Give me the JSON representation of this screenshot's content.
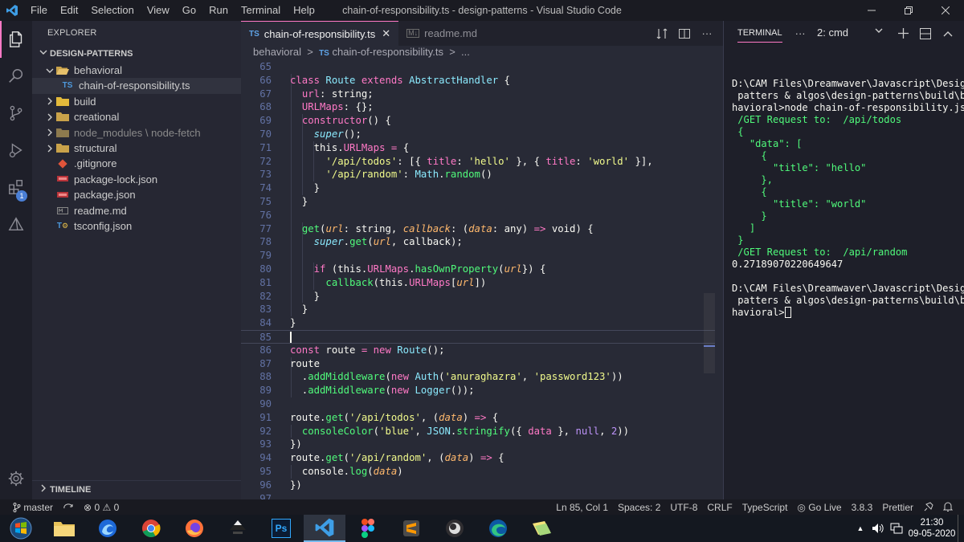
{
  "window": {
    "title": "chain-of-responsibility.ts - design-patterns - Visual Studio Code",
    "menu": [
      "File",
      "Edit",
      "Selection",
      "View",
      "Go",
      "Run",
      "Terminal",
      "Help"
    ]
  },
  "activity_bar": {
    "items": [
      "explorer-icon",
      "search-icon",
      "source-control-icon",
      "run-debug-icon",
      "extensions-icon",
      "remote-icon"
    ],
    "extensions_badge": "1",
    "bottom": "settings-gear-icon"
  },
  "sidebar": {
    "header": "EXPLORER",
    "project": "DESIGN-PATTERNS",
    "tree": [
      {
        "label": "behavioral",
        "kind": "folder-open",
        "depth": 0
      },
      {
        "label": "chain-of-responsibility.ts",
        "kind": "ts",
        "depth": 1,
        "selected": true
      },
      {
        "label": "build",
        "kind": "folder",
        "depth": 0
      },
      {
        "label": "creational",
        "kind": "folder",
        "depth": 0
      },
      {
        "label": "node_modules",
        "suffix": "node-fetch",
        "kind": "folder-dim",
        "depth": 0
      },
      {
        "label": "structural",
        "kind": "folder",
        "depth": 0
      },
      {
        "label": ".gitignore",
        "kind": "git",
        "depth": 0
      },
      {
        "label": "package-lock.json",
        "kind": "npm",
        "depth": 0
      },
      {
        "label": "package.json",
        "kind": "npm",
        "depth": 0
      },
      {
        "label": "readme.md",
        "kind": "md",
        "depth": 0
      },
      {
        "label": "tsconfig.json",
        "kind": "tsconfig",
        "depth": 0
      }
    ],
    "timeline": "TIMELINE"
  },
  "editor": {
    "tabs": [
      {
        "badge": "TS",
        "label": "chain-of-responsibility.ts",
        "active": true
      },
      {
        "badge": "M↓",
        "label": "readme.md",
        "active": false
      }
    ],
    "breadcrumb": {
      "folder": "behavioral",
      "badge": "TS",
      "file": "chain-of-responsibility.ts",
      "tail": "..."
    },
    "current_line": 85,
    "lines": [
      {
        "n": "65",
        "t": []
      },
      {
        "n": "66",
        "t": [
          [
            "k",
            "class "
          ],
          [
            "c",
            "Route "
          ],
          [
            "k",
            "extends "
          ],
          [
            "c",
            "AbstractHandler "
          ],
          [
            "",
            "{"
          ]
        ]
      },
      {
        "n": "67",
        "t": [
          [
            "",
            "  "
          ],
          [
            "k",
            "url"
          ],
          [
            "",
            ": "
          ],
          [
            "",
            "string;"
          ]
        ]
      },
      {
        "n": "68",
        "t": [
          [
            "",
            "  "
          ],
          [
            "k",
            "URLMaps"
          ],
          [
            "",
            ": {};"
          ]
        ]
      },
      {
        "n": "69",
        "t": [
          [
            "",
            "  "
          ],
          [
            "k",
            "constructor"
          ],
          [
            "",
            "() {"
          ]
        ]
      },
      {
        "n": "70",
        "t": [
          [
            "",
            "    "
          ],
          [
            "i",
            "super"
          ],
          [
            "",
            "();"
          ]
        ]
      },
      {
        "n": "71",
        "t": [
          [
            "",
            "    "
          ],
          [
            "",
            "this."
          ],
          [
            "k",
            "URLMaps"
          ],
          [
            "k",
            " = "
          ],
          [
            "",
            "{"
          ]
        ]
      },
      {
        "n": "72",
        "t": [
          [
            "",
            "      "
          ],
          [
            "s",
            "'/api/todos'"
          ],
          [
            "",
            ": [{ "
          ],
          [
            "k",
            "title"
          ],
          [
            "",
            ": "
          ],
          [
            "s",
            "'hello'"
          ],
          [
            "",
            " }, { "
          ],
          [
            "k",
            "title"
          ],
          [
            "",
            ": "
          ],
          [
            "s",
            "'world'"
          ],
          [
            "",
            " }],"
          ]
        ]
      },
      {
        "n": "73",
        "t": [
          [
            "",
            "      "
          ],
          [
            "s",
            "'/api/random'"
          ],
          [
            "",
            ": "
          ],
          [
            "c",
            "Math"
          ],
          [
            "",
            "."
          ],
          [
            "f",
            "random"
          ],
          [
            "",
            "()"
          ]
        ]
      },
      {
        "n": "74",
        "t": [
          [
            "",
            "    }"
          ]
        ]
      },
      {
        "n": "75",
        "t": [
          [
            "",
            "  }"
          ]
        ]
      },
      {
        "n": "76",
        "t": []
      },
      {
        "n": "77",
        "t": [
          [
            "",
            "  "
          ],
          [
            "f",
            "get"
          ],
          [
            "",
            "("
          ],
          [
            "p",
            "url"
          ],
          [
            "",
            ": string, "
          ],
          [
            "p",
            "callback"
          ],
          [
            "",
            ": ("
          ],
          [
            "p",
            "data"
          ],
          [
            "",
            ": any) "
          ],
          [
            "k",
            "=>"
          ],
          [
            "",
            " void) {"
          ]
        ]
      },
      {
        "n": "78",
        "t": [
          [
            "",
            "    "
          ],
          [
            "i",
            "super"
          ],
          [
            "",
            "."
          ],
          [
            "f",
            "get"
          ],
          [
            "",
            "("
          ],
          [
            "p",
            "url"
          ],
          [
            "",
            ", callback);"
          ]
        ]
      },
      {
        "n": "79",
        "t": []
      },
      {
        "n": "80",
        "t": [
          [
            "",
            "    "
          ],
          [
            "k",
            "if"
          ],
          [
            "",
            " (this."
          ],
          [
            "k",
            "URLMaps"
          ],
          [
            "",
            "."
          ],
          [
            "f",
            "hasOwnProperty"
          ],
          [
            "",
            "("
          ],
          [
            "p",
            "url"
          ],
          [
            "",
            "}) {"
          ]
        ]
      },
      {
        "n": "81",
        "t": [
          [
            "",
            "      "
          ],
          [
            "f",
            "callback"
          ],
          [
            "",
            "(this."
          ],
          [
            "k",
            "URLMaps"
          ],
          [
            "",
            "["
          ],
          [
            "p",
            "url"
          ],
          [
            "",
            "])"
          ]
        ]
      },
      {
        "n": "82",
        "t": [
          [
            "",
            "    }"
          ]
        ]
      },
      {
        "n": "83",
        "t": [
          [
            "",
            "  }"
          ]
        ]
      },
      {
        "n": "84",
        "t": [
          [
            "",
            "}"
          ]
        ]
      },
      {
        "n": "85",
        "t": []
      },
      {
        "n": "86",
        "t": [
          [
            "k",
            "const "
          ],
          [
            "",
            "route "
          ],
          [
            "k",
            "= new "
          ],
          [
            "c",
            "Route"
          ],
          [
            "",
            "();"
          ]
        ]
      },
      {
        "n": "87",
        "t": [
          [
            "",
            "route"
          ]
        ]
      },
      {
        "n": "88",
        "t": [
          [
            "",
            "  ."
          ],
          [
            "f",
            "addMiddleware"
          ],
          [
            "",
            "("
          ],
          [
            "k",
            "new "
          ],
          [
            "c",
            "Auth"
          ],
          [
            "",
            "("
          ],
          [
            "s",
            "'anuraghazra'"
          ],
          [
            "",
            ", "
          ],
          [
            "s",
            "'password123'"
          ],
          [
            "",
            "))"
          ]
        ]
      },
      {
        "n": "89",
        "t": [
          [
            "",
            "  ."
          ],
          [
            "f",
            "addMiddleware"
          ],
          [
            "",
            "("
          ],
          [
            "k",
            "new "
          ],
          [
            "c",
            "Logger"
          ],
          [
            "",
            "());"
          ]
        ]
      },
      {
        "n": "90",
        "t": []
      },
      {
        "n": "91",
        "t": [
          [
            "",
            "route."
          ],
          [
            "f",
            "get"
          ],
          [
            "",
            "("
          ],
          [
            "s",
            "'/api/todos'"
          ],
          [
            "",
            ", ("
          ],
          [
            "p",
            "data"
          ],
          [
            "",
            ") "
          ],
          [
            "k",
            "=>"
          ],
          [
            "",
            " {"
          ]
        ]
      },
      {
        "n": "92",
        "t": [
          [
            "",
            "  "
          ],
          [
            "f",
            "consoleColor"
          ],
          [
            "",
            "("
          ],
          [
            "s",
            "'blue'"
          ],
          [
            "",
            ", "
          ],
          [
            "c",
            "JSON"
          ],
          [
            "",
            "."
          ],
          [
            "f",
            "stringify"
          ],
          [
            "",
            "({ "
          ],
          [
            "k",
            "data"
          ],
          [
            "",
            " }, "
          ],
          [
            "n",
            "null"
          ],
          [
            "",
            ", "
          ],
          [
            "n",
            "2"
          ],
          [
            "",
            "))"
          ]
        ]
      },
      {
        "n": "93",
        "t": [
          [
            "",
            "})"
          ]
        ]
      },
      {
        "n": "94",
        "t": [
          [
            "",
            "route."
          ],
          [
            "f",
            "get"
          ],
          [
            "",
            "("
          ],
          [
            "s",
            "'/api/random'"
          ],
          [
            "",
            ", ("
          ],
          [
            "p",
            "data"
          ],
          [
            "",
            ") "
          ],
          [
            "k",
            "=>"
          ],
          [
            "",
            " {"
          ]
        ]
      },
      {
        "n": "95",
        "t": [
          [
            "",
            "  "
          ],
          [
            "",
            "console."
          ],
          [
            "f",
            "log"
          ],
          [
            "",
            "("
          ],
          [
            "p",
            "data"
          ],
          [
            "",
            ")"
          ]
        ]
      },
      {
        "n": "96",
        "t": [
          [
            "",
            "})"
          ]
        ]
      },
      {
        "n": "97",
        "t": []
      }
    ]
  },
  "panel": {
    "tab": "TERMINAL",
    "terminal_select": "2: cmd",
    "output": [
      {
        "text": "",
        "style": ""
      },
      {
        "text": "D:\\CAM Files\\Dreamwaver\\Javascript\\Design",
        "style": ""
      },
      {
        "text": " patters & algos\\design-patterns\\build\\be",
        "style": ""
      },
      {
        "text": "havioral>node chain-of-responsibility.js",
        "style": ""
      },
      {
        "text": " /GET Request to:  /api/todos",
        "style": "green"
      },
      {
        "text": " {",
        "style": "green"
      },
      {
        "text": "   \"data\": [",
        "style": "green"
      },
      {
        "text": "     {",
        "style": "green"
      },
      {
        "text": "       \"title\": \"hello\"",
        "style": "green"
      },
      {
        "text": "     },",
        "style": "green"
      },
      {
        "text": "     {",
        "style": "green"
      },
      {
        "text": "       \"title\": \"world\"",
        "style": "green"
      },
      {
        "text": "     }",
        "style": "green"
      },
      {
        "text": "   ]",
        "style": "green"
      },
      {
        "text": " }",
        "style": "green"
      },
      {
        "text": " /GET Request to:  /api/random",
        "style": "green"
      },
      {
        "text": "0.27189070220649647",
        "style": ""
      },
      {
        "text": "",
        "style": ""
      },
      {
        "text": "D:\\CAM Files\\Dreamwaver\\Javascript\\Design",
        "style": ""
      },
      {
        "text": " patters & algos\\design-patterns\\build\\be",
        "style": ""
      },
      {
        "text": "havioral>",
        "style": "prompt"
      }
    ]
  },
  "statusbar": {
    "branch": "master",
    "errors": "0",
    "warnings": "0",
    "position": "Ln 85, Col 1",
    "spaces": "Spaces: 2",
    "encoding": "UTF-8",
    "eol": "CRLF",
    "language": "TypeScript",
    "golive": "Go Live",
    "ts_version": "3.8.3",
    "prettier": "Prettier"
  },
  "taskbar": {
    "apps": [
      "windows-start-icon",
      "file-explorer-icon",
      "firefox-dev-icon",
      "chrome-icon",
      "firefox-icon",
      "inkscape-icon",
      "photoshop-icon",
      "vscode-icon",
      "figma-icon",
      "sublime-icon",
      "obs-icon",
      "edge-icon",
      "notes-icon"
    ],
    "photoshop_label": "Ps",
    "time": "21:30",
    "date": "09-05-2020"
  },
  "colors": {
    "accent": "#ff79c6",
    "editor_bg": "#282a36",
    "terminal_green": "#50fa7b"
  }
}
